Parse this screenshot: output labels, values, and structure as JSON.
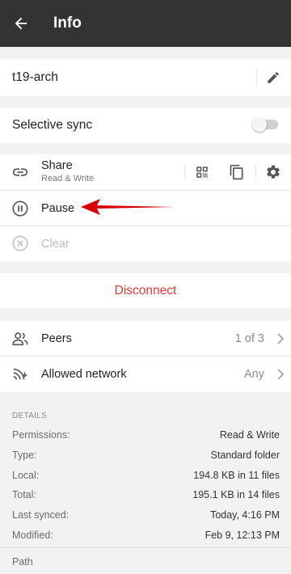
{
  "appbar": {
    "title": "Info",
    "back_icon": "arrow-left-icon"
  },
  "folder": {
    "name": "t19-arch",
    "edit_icon": "pencil-icon"
  },
  "selective_sync": {
    "label": "Selective sync",
    "enabled": false
  },
  "share": {
    "title": "Share",
    "subtitle": "Read & Write",
    "icons": [
      "qr-code-icon",
      "copy-icon",
      "gear-icon"
    ]
  },
  "pause": {
    "label": "Pause"
  },
  "clear": {
    "label": "Clear"
  },
  "disconnect": {
    "label": "Disconnect",
    "color": "#e53935"
  },
  "peers": {
    "label": "Peers",
    "value": "1 of 3"
  },
  "allowed_network": {
    "label": "Allowed network",
    "value": "Any"
  },
  "details": {
    "header": "DETAILS",
    "rows": [
      {
        "key": "Permissions:",
        "value": "Read & Write"
      },
      {
        "key": "Type:",
        "value": "Standard folder"
      },
      {
        "key": "Local:",
        "value": "194.8 KB in 11 files"
      },
      {
        "key": "Total:",
        "value": "195.1 KB in 14 files"
      },
      {
        "key": "Last synced:",
        "value": "Today, 4:16 PM"
      },
      {
        "key": "Modified:",
        "value": "Feb 9, 12:13 PM"
      }
    ]
  },
  "path": {
    "label": "Path"
  },
  "colors": {
    "appbar": "#333333",
    "accent_red": "#e53935",
    "annotation_arrow": "#d50000"
  }
}
